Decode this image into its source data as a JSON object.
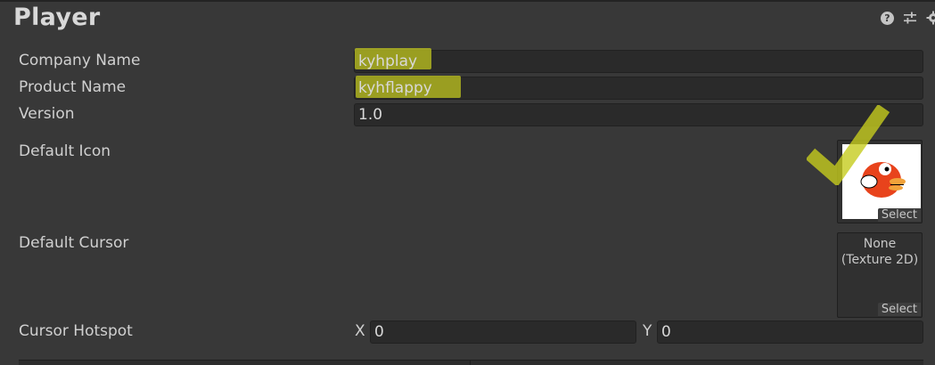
{
  "panel": {
    "title": "Player",
    "icons": [
      "help-icon",
      "preset-icon",
      "gear-icon"
    ]
  },
  "fields": {
    "company_name": {
      "label": "Company Name",
      "value": "kyhplay"
    },
    "product_name": {
      "label": "Product Name",
      "value": "kyhflappy"
    },
    "version": {
      "label": "Version",
      "value": "1.0"
    }
  },
  "default_icon": {
    "label": "Default Icon",
    "select_label": "Select",
    "image": "flappy-bird-icon"
  },
  "default_cursor": {
    "label": "Default Cursor",
    "none_line1": "None",
    "none_line2": "(Texture 2D)",
    "select_label": "Select"
  },
  "cursor_hotspot": {
    "label": "Cursor Hotspot",
    "x_label": "X",
    "x_value": "0",
    "y_label": "Y",
    "y_value": "0"
  },
  "colors": {
    "highlight": "#c6cc1e",
    "background": "#383838",
    "field": "#2a2a2a"
  }
}
